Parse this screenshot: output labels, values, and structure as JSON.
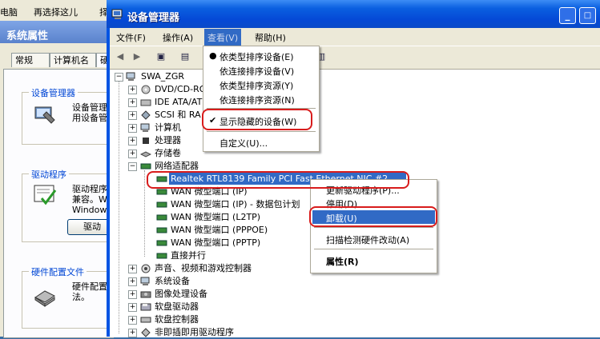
{
  "desktop": {
    "item1": "电脑",
    "item2": "再选择这儿",
    "item3": "择"
  },
  "sysprop": {
    "title": "系统属性",
    "tabs": [
      "常规",
      "计算机名",
      "硬"
    ],
    "groups": [
      {
        "legend": "设备管理器",
        "lines": [
          "设备管理",
          "用设备管"
        ]
      },
      {
        "legend": "驱动程序",
        "lines": [
          "驱动程序",
          "兼容。Wi",
          "Windows"
        ],
        "button": "驱动"
      },
      {
        "legend": "硬件配置文件",
        "lines": [
          "硬件配置",
          "法。"
        ]
      }
    ]
  },
  "window": {
    "title": "设备管理器",
    "min_label": "_",
    "max_label": "□",
    "menus": [
      "文件(F)",
      "操作(A)",
      "查看(V)",
      "帮助(H)"
    ]
  },
  "view_menu": {
    "items": [
      {
        "label": "依类型排序设备(E)",
        "mark": "●"
      },
      {
        "label": "依连接排序设备(V)",
        "mark": ""
      },
      {
        "label": "依类型排序资源(Y)",
        "mark": ""
      },
      {
        "label": "依连接排序资源(N)",
        "mark": ""
      },
      {
        "label": "显示隐藏的设备(W)",
        "mark": "✔"
      },
      {
        "label": "自定义(U)...",
        "mark": ""
      }
    ]
  },
  "tree": {
    "root": "SWA_ZGR",
    "categories": [
      "DVD/CD-ROM",
      "IDE ATA/AT",
      "SCSI 和 RA",
      "计算机",
      "处理器",
      "存储卷",
      "网络适配器"
    ],
    "adapters": [
      "Realtek RTL8139 Family PCI Fast Ethernet NIC #2",
      "WAN 微型端口 (IP)",
      "WAN 微型端口 (IP) - 数据包计划",
      "WAN 微型端口 (L2TP)",
      "WAN 微型端口 (PPPOE)",
      "WAN 微型端口 (PPTP)",
      "直接并行"
    ],
    "more_categories": [
      "声音、视频和游戏控制器",
      "系统设备",
      "图像处理设备",
      "软盘驱动器",
      "软盘控制器",
      "非即插即用驱动程序"
    ]
  },
  "context_menu": {
    "items": [
      "更新驱动程序(P)...",
      "停用(D)",
      "卸载(U)",
      "扫描检测硬件改动(A)",
      "属性(R)"
    ]
  }
}
